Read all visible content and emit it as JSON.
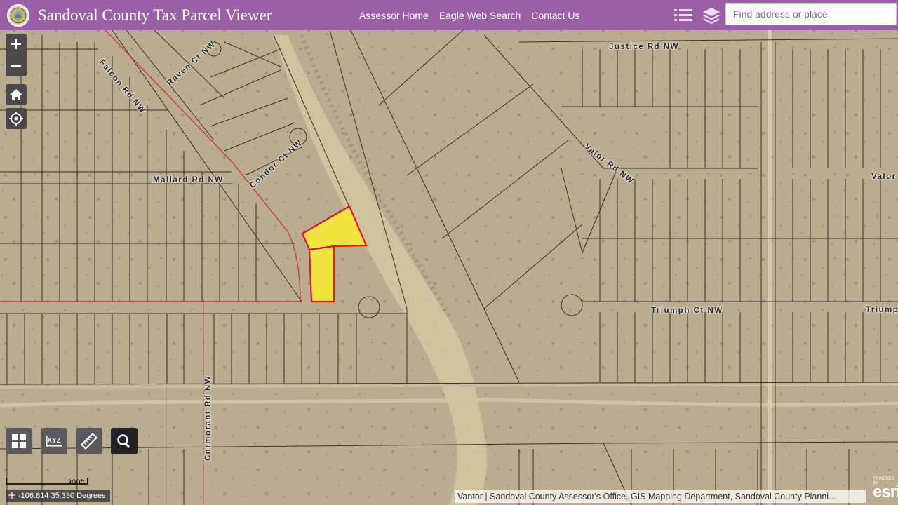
{
  "header": {
    "title": "Sandoval County Tax Parcel Viewer",
    "nav": [
      "Assessor Home",
      "Eagle Web Search",
      "Contact Us"
    ],
    "search_placeholder": "Find address or place",
    "accent_color": "#9b5fa8"
  },
  "icons": {
    "logo": "county-seal-icon",
    "list": "list-icon",
    "layers": "layers-icon",
    "zoom_in": "plus-icon",
    "zoom_out": "minus-icon",
    "home": "home-icon",
    "locate": "locate-icon",
    "basemap": "grid-icon",
    "coordinate": "xyz-icon",
    "measure": "ruler-icon",
    "search": "search-icon"
  },
  "map": {
    "road_labels": {
      "falcon": "Falcon Rd NW",
      "raven": "Raven Ct NW",
      "justice": "Justice Rd NW",
      "condor": "Condor Ct NW",
      "valor": "Valor Rd NW",
      "valor_east": "Valor",
      "mallard": "Mallard Rd NW",
      "triumph": "Triumph Ct NW",
      "triumph_east": "Triumph",
      "cormorant": "Cormorant Rd NW"
    },
    "highlight_color": "#f2e83a",
    "highlight_outline": "#e01010"
  },
  "scale": {
    "label": "300ft"
  },
  "coordinates": {
    "text": "-106.814 35.330 Degrees"
  },
  "attribution": {
    "text": "Vantor | Sandoval County Assessor's Office, GIS Mapping Department, Sandoval County Planni..."
  },
  "esri": {
    "powered": "POWERED BY",
    "logo": "esri"
  }
}
